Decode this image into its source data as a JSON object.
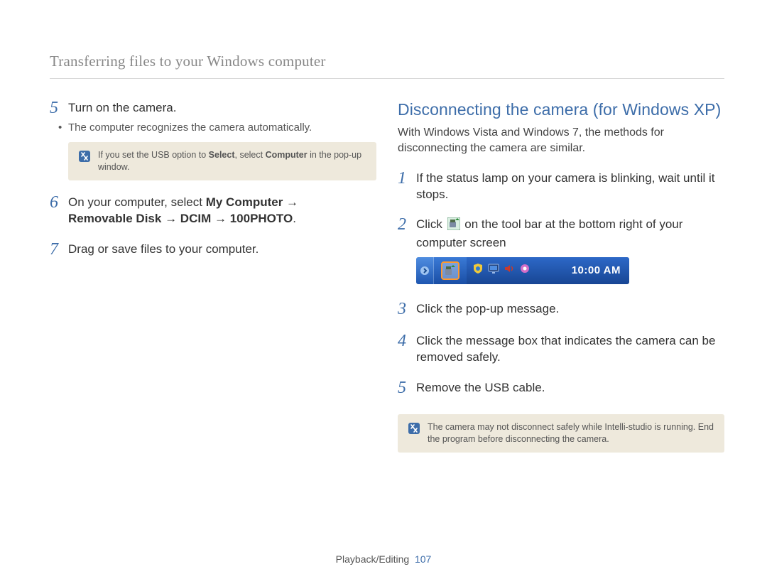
{
  "header": {
    "title": "Transferring files to your Windows computer"
  },
  "left": {
    "step5": {
      "num": "5",
      "text": "Turn on the camera.",
      "bullet": "The computer recognizes the camera automatically.",
      "note_pre": "If you set the USB option to ",
      "note_bold1": "Select",
      "note_mid": ", select ",
      "note_bold2": "Computer",
      "note_post": " in the pop-up window."
    },
    "step6": {
      "num": "6",
      "pre": "On your computer, select ",
      "bold1": "My Computer",
      "arrow": " → ",
      "bold2": "Removable Disk",
      "bold3": "DCIM",
      "bold4": "100PHOTO",
      "period": "."
    },
    "step7": {
      "num": "7",
      "text": "Drag or save files to your computer."
    }
  },
  "right": {
    "heading": "Disconnecting the camera (for Windows XP)",
    "intro": "With Windows Vista and Windows 7, the methods for disconnecting the camera are similar.",
    "step1": {
      "num": "1",
      "text": "If the status lamp on your camera is blinking, wait until it stops."
    },
    "step2": {
      "num": "2",
      "pre": "Click ",
      "post": " on the tool bar at the bottom right of your computer screen"
    },
    "tray_time": "10:00 AM",
    "step3": {
      "num": "3",
      "text": "Click the pop-up message."
    },
    "step4": {
      "num": "4",
      "text": "Click the message box that indicates the camera can be removed safely."
    },
    "step5": {
      "num": "5",
      "text": "Remove the USB cable."
    },
    "note": "The camera may not disconnect safely while Intelli-studio is running. End the program before disconnecting the camera."
  },
  "footer": {
    "section": "Playback/Editing",
    "page": "107"
  }
}
